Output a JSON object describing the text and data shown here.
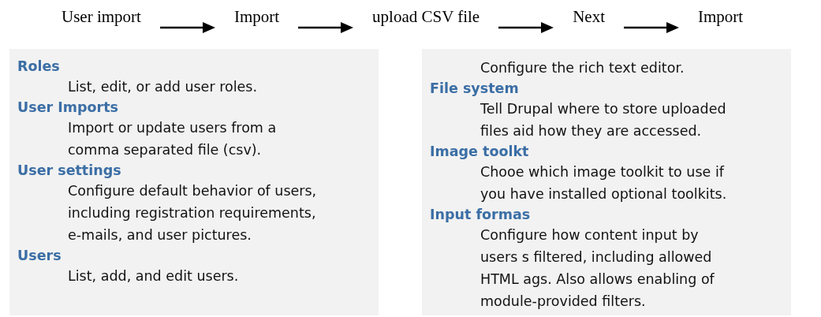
{
  "flow": [
    {
      "label": "User import"
    },
    {
      "label": "Import"
    },
    {
      "label": "upload CSV file"
    },
    {
      "label": "Next"
    },
    {
      "label": "Import"
    }
  ],
  "panels": [
    {
      "items": [
        {
          "title": "Roles",
          "lines": [
            "List, edit, or add user roles."
          ]
        },
        {
          "title": "User Imports",
          "lines": [
            "Import or update users from a",
            "comma separated file (csv)."
          ]
        },
        {
          "title": "User settings",
          "lines": [
            "Configure default behavior of users,",
            "including registration requirements,",
            "e-mails, and user pictures."
          ]
        },
        {
          "title": "Users",
          "lines": [
            "List, add, and edit users."
          ]
        }
      ]
    },
    {
      "items": [
        {
          "lines": [
            "Configure the rich text editor."
          ]
        },
        {
          "title": "File system",
          "lines": [
            "Tell Drupal where to store uploaded",
            "files aid how they are accessed."
          ]
        },
        {
          "title": "Image toolkt",
          "lines": [
            "Chooe which image toolkit to use if",
            "you have installed optional toolkits."
          ]
        },
        {
          "title": "Input formas",
          "lines": [
            "Configure how content input by",
            "users s filtered, including allowed",
            "HTML ags. Also allows enabling of",
            "module-provided filters."
          ]
        }
      ]
    }
  ]
}
